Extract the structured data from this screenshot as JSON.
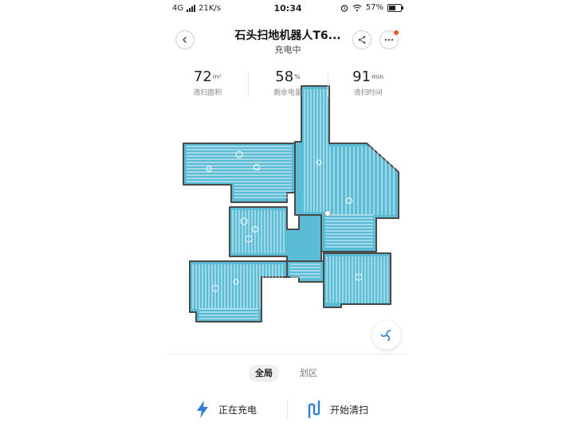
{
  "status_bar": {
    "network": "4G",
    "speed": "21K/s",
    "time": "10:34",
    "battery": "57%",
    "battery_level": 0.57
  },
  "header": {
    "title": "石头扫地机器人T6...",
    "subtitle": "充电中",
    "notification_dot_color": "#f05a1e"
  },
  "stats": [
    {
      "value": "72",
      "unit": "m²",
      "label": "清扫面积"
    },
    {
      "value": "58",
      "unit": "%",
      "label": "剩余电量"
    },
    {
      "value": "91",
      "unit": "min",
      "label": "清扫时间"
    }
  ],
  "map": {
    "floor_color": "#5bbcd6",
    "wall_color": "#4a4a4a",
    "path_color": "#ffffff"
  },
  "tabs": [
    {
      "label": "全局",
      "active": true
    },
    {
      "label": "划区",
      "active": false
    }
  ],
  "actions": {
    "charge_label": "正在充电",
    "start_label": "开始清扫",
    "accent_color": "#2f7ed8"
  }
}
